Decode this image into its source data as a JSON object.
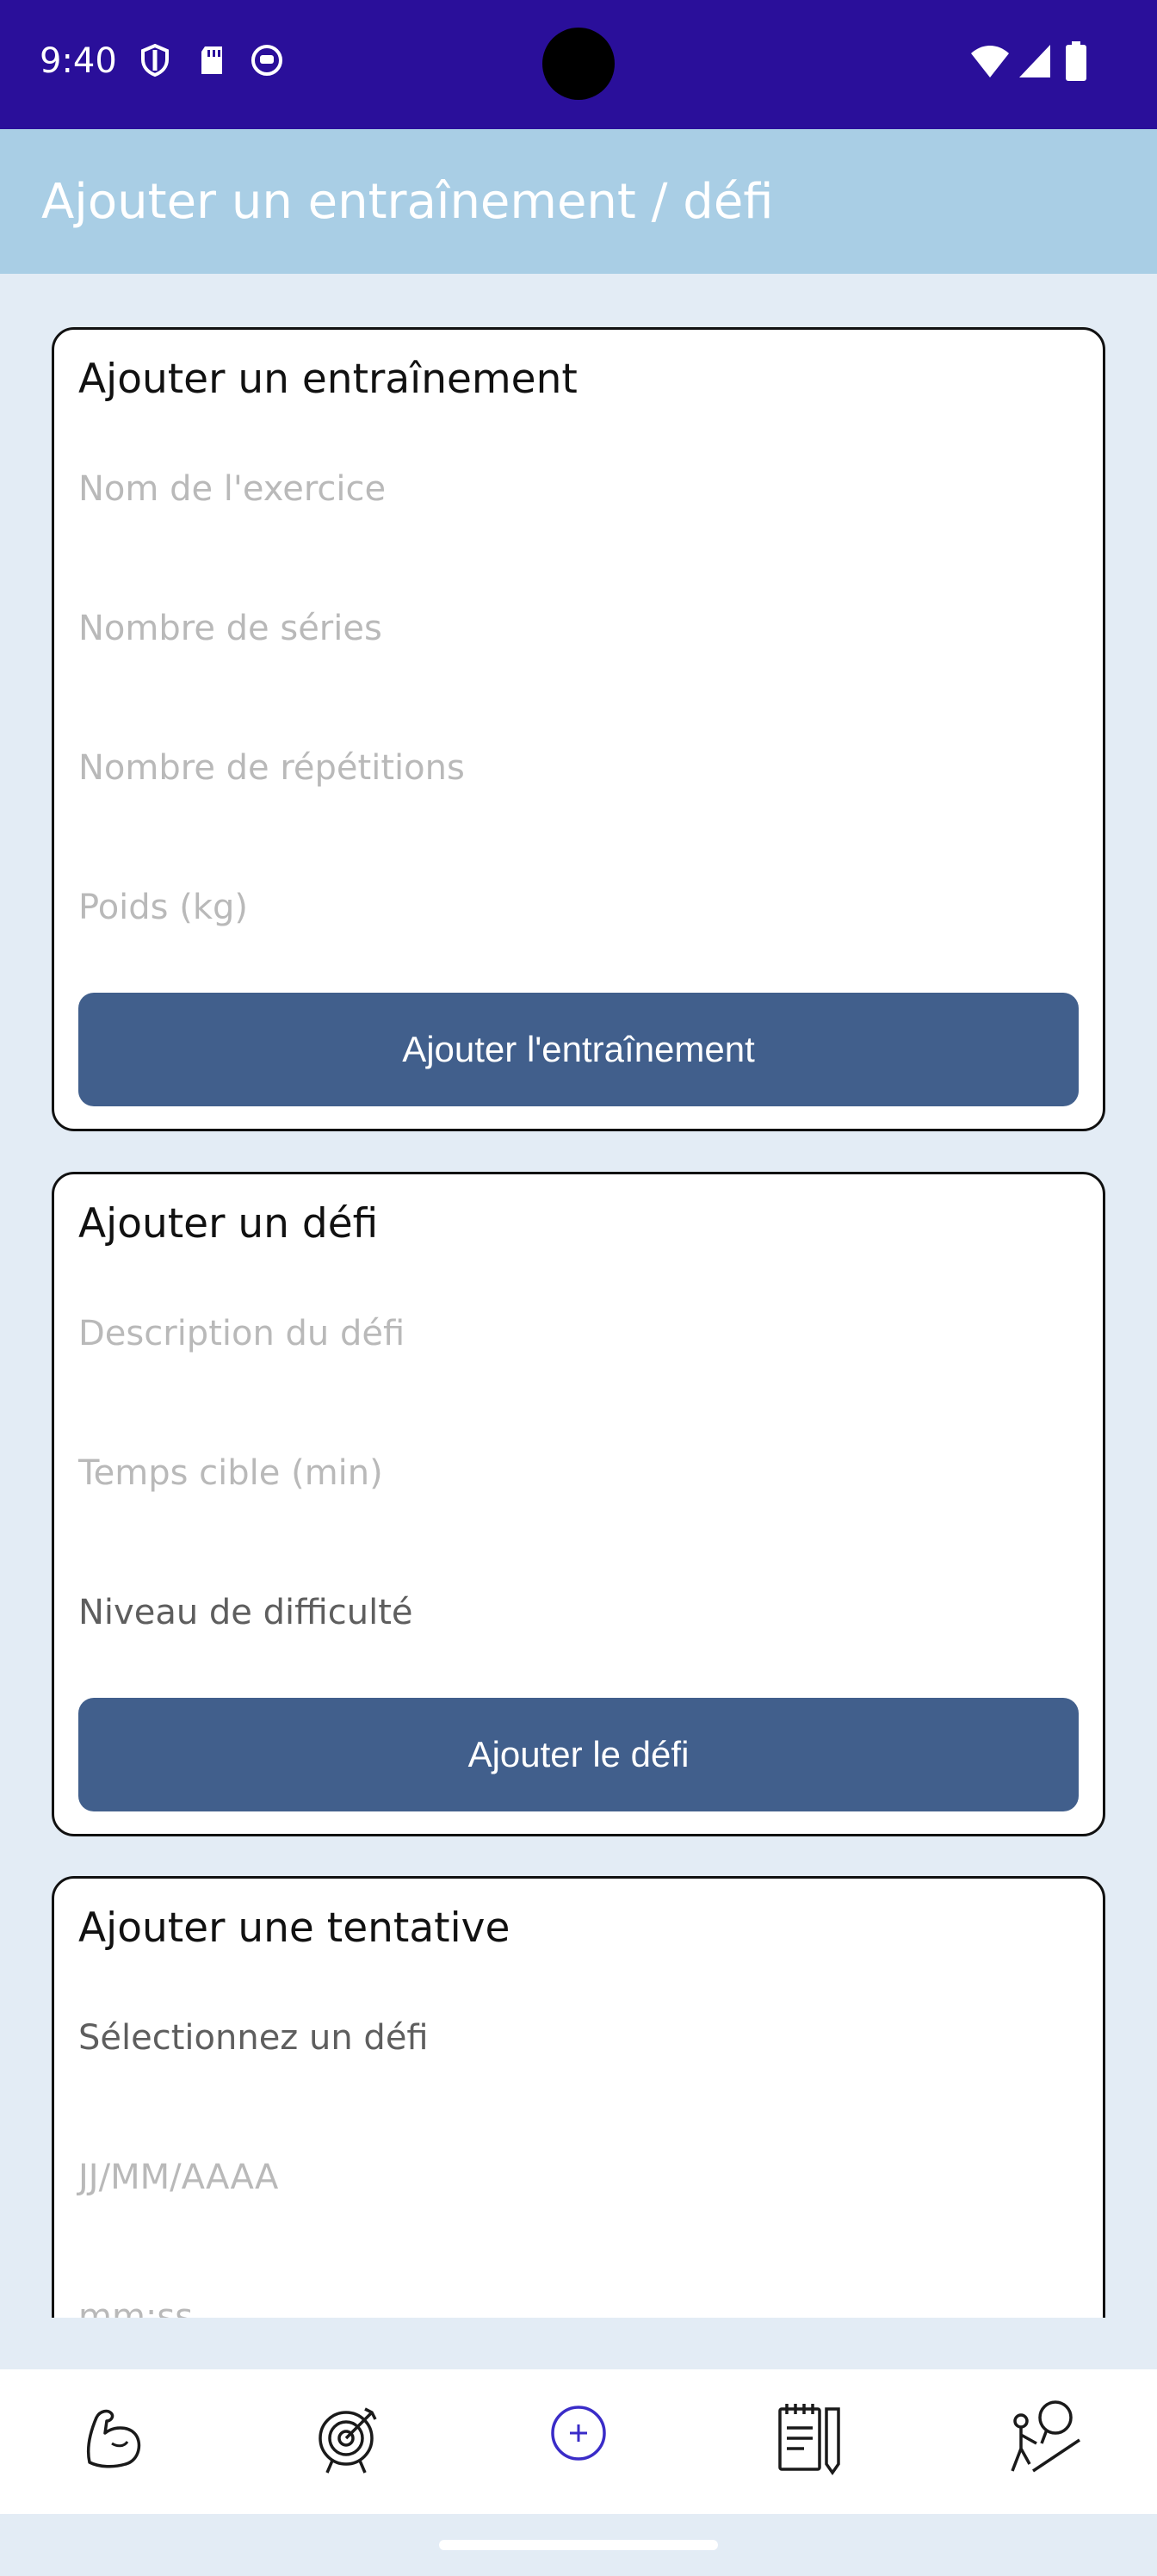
{
  "status_bar": {
    "time": "9:40"
  },
  "app_bar": {
    "title": "Ajouter un entraînement / défi"
  },
  "workout_card": {
    "title": "Ajouter un entraînement",
    "fields": {
      "exercise_name": "Nom de l'exercice",
      "sets": "Nombre de séries",
      "reps": "Nombre de répétitions",
      "weight": "Poids (kg)"
    },
    "button": "Ajouter l'entraînement"
  },
  "challenge_card": {
    "title": "Ajouter un défi",
    "fields": {
      "description": "Description du défi",
      "target_time": "Temps cible (min)",
      "difficulty": "Niveau de difficulté"
    },
    "button": "Ajouter le défi"
  },
  "attempt_card": {
    "title": "Ajouter une tentative",
    "fields": {
      "challenge_select": "Sélectionnez un défi",
      "date": "JJ/MM/AAAA",
      "time": "mm:ss"
    }
  },
  "bottom_nav": {
    "items": [
      "workout-icon",
      "target-icon",
      "add-icon",
      "journal-icon",
      "profile-goal-icon"
    ],
    "active_color": "#3a2cc8"
  }
}
